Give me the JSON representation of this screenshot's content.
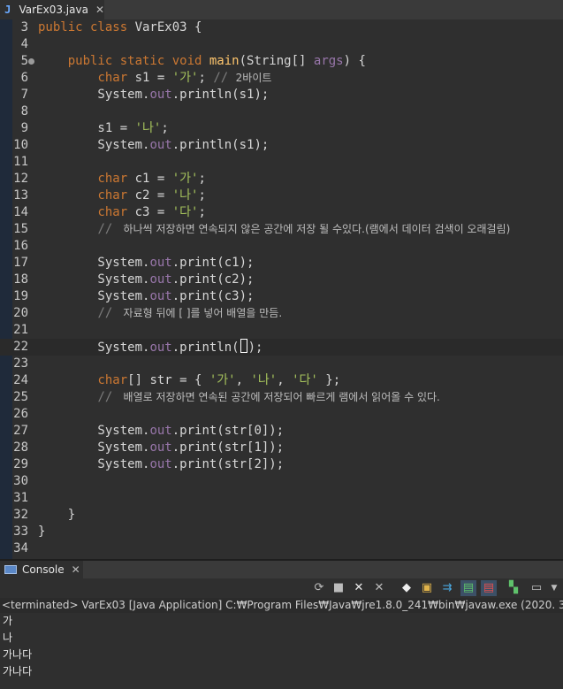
{
  "editor": {
    "tab_label": "VarEx03.java",
    "tab_icon": "J",
    "lines": [
      {
        "n": "3",
        "parts": [
          [
            "kw",
            "public class "
          ],
          [
            "plain",
            "VarEx03 {"
          ]
        ]
      },
      {
        "n": "4",
        "parts": []
      },
      {
        "n": "5",
        "fold": true,
        "parts": [
          [
            "plain",
            "    "
          ],
          [
            "kw",
            "public static void "
          ],
          [
            "fn",
            "main"
          ],
          [
            "plain",
            "(String[] "
          ],
          [
            "fld",
            "args"
          ],
          [
            "plain",
            ") {"
          ]
        ]
      },
      {
        "n": "6",
        "parts": [
          [
            "plain",
            "        "
          ],
          [
            "kw",
            "char "
          ],
          [
            "plain",
            "s1 = "
          ],
          [
            "str",
            "'가'"
          ],
          [
            "plain",
            "; "
          ],
          [
            "cm",
            "// "
          ],
          [
            "cmk",
            "2바이트"
          ]
        ]
      },
      {
        "n": "7",
        "parts": [
          [
            "plain",
            "        System."
          ],
          [
            "fld",
            "out"
          ],
          [
            "plain",
            ".println(s1);"
          ]
        ]
      },
      {
        "n": "8",
        "parts": []
      },
      {
        "n": "9",
        "parts": [
          [
            "plain",
            "        s1 = "
          ],
          [
            "str",
            "'나'"
          ],
          [
            "plain",
            ";"
          ]
        ]
      },
      {
        "n": "10",
        "parts": [
          [
            "plain",
            "        System."
          ],
          [
            "fld",
            "out"
          ],
          [
            "plain",
            ".println(s1);"
          ]
        ]
      },
      {
        "n": "11",
        "parts": []
      },
      {
        "n": "12",
        "parts": [
          [
            "plain",
            "        "
          ],
          [
            "kw",
            "char "
          ],
          [
            "plain",
            "c1 = "
          ],
          [
            "str",
            "'가'"
          ],
          [
            "plain",
            ";"
          ]
        ]
      },
      {
        "n": "13",
        "parts": [
          [
            "plain",
            "        "
          ],
          [
            "kw",
            "char "
          ],
          [
            "plain",
            "c2 = "
          ],
          [
            "str",
            "'나'"
          ],
          [
            "plain",
            ";"
          ]
        ]
      },
      {
        "n": "14",
        "parts": [
          [
            "plain",
            "        "
          ],
          [
            "kw",
            "char "
          ],
          [
            "plain",
            "c3 = "
          ],
          [
            "str",
            "'다'"
          ],
          [
            "plain",
            ";"
          ]
        ]
      },
      {
        "n": "15",
        "parts": [
          [
            "plain",
            "        "
          ],
          [
            "cm",
            "// "
          ],
          [
            "cmk",
            " 하나씩 저장하면 연속되지 않은 공간에 저장 될 수있다.(램에서 데이터 검색이 오래걸림)"
          ]
        ]
      },
      {
        "n": "16",
        "parts": []
      },
      {
        "n": "17",
        "parts": [
          [
            "plain",
            "        System."
          ],
          [
            "fld",
            "out"
          ],
          [
            "plain",
            ".print(c1);"
          ]
        ]
      },
      {
        "n": "18",
        "parts": [
          [
            "plain",
            "        System."
          ],
          [
            "fld",
            "out"
          ],
          [
            "plain",
            ".print(c2);"
          ]
        ]
      },
      {
        "n": "19",
        "parts": [
          [
            "plain",
            "        System."
          ],
          [
            "fld",
            "out"
          ],
          [
            "plain",
            ".print(c3);"
          ]
        ]
      },
      {
        "n": "20",
        "parts": [
          [
            "plain",
            "        "
          ],
          [
            "cm",
            "// "
          ],
          [
            "cmk",
            " 자료형 뒤에 [ ]를 넣어 배열을 만듬."
          ]
        ]
      },
      {
        "n": "21",
        "parts": []
      },
      {
        "n": "22",
        "current": true,
        "parts": [
          [
            "plain",
            "        System."
          ],
          [
            "fld",
            "out"
          ],
          [
            "plain",
            ".println("
          ],
          [
            "caret",
            ""
          ],
          [
            "plain",
            ");"
          ]
        ]
      },
      {
        "n": "23",
        "parts": []
      },
      {
        "n": "24",
        "parts": [
          [
            "plain",
            "        "
          ],
          [
            "kw",
            "char"
          ],
          [
            "plain",
            "[] str = { "
          ],
          [
            "str",
            "'가'"
          ],
          [
            "plain",
            ", "
          ],
          [
            "str",
            "'나'"
          ],
          [
            "plain",
            ", "
          ],
          [
            "str",
            "'다'"
          ],
          [
            "plain",
            " };"
          ]
        ]
      },
      {
        "n": "25",
        "parts": [
          [
            "plain",
            "        "
          ],
          [
            "cm",
            "// "
          ],
          [
            "cmk",
            " 배열로 저장하면 연속된 공간에 저장되어 빠르게 램에서 읽어올 수 있다."
          ]
        ]
      },
      {
        "n": "26",
        "parts": []
      },
      {
        "n": "27",
        "parts": [
          [
            "plain",
            "        System."
          ],
          [
            "fld",
            "out"
          ],
          [
            "plain",
            ".print(str[0]);"
          ]
        ]
      },
      {
        "n": "28",
        "parts": [
          [
            "plain",
            "        System."
          ],
          [
            "fld",
            "out"
          ],
          [
            "plain",
            ".print(str[1]);"
          ]
        ]
      },
      {
        "n": "29",
        "parts": [
          [
            "plain",
            "        System."
          ],
          [
            "fld",
            "out"
          ],
          [
            "plain",
            ".print(str[2]);"
          ]
        ]
      },
      {
        "n": "30",
        "parts": []
      },
      {
        "n": "31",
        "parts": []
      },
      {
        "n": "32",
        "parts": [
          [
            "plain",
            "    }"
          ]
        ]
      },
      {
        "n": "33",
        "parts": [
          [
            "plain",
            "}"
          ]
        ]
      },
      {
        "n": "34",
        "parts": []
      }
    ]
  },
  "console": {
    "tab_label": "Console",
    "status": "<terminated> VarEx03 [Java Application] C:₩Program Files₩Java₩jre1.8.0_241₩bin₩javaw.exe (2020. 3. 17. 오전 11:4",
    "output": [
      "가",
      "나",
      "가나다",
      "가나다"
    ],
    "toolbar_icons": [
      "refresh-icon",
      "stop-icon",
      "remove-launch-icon",
      "remove-all-icon",
      "clear-console-icon",
      "scroll-lock-icon",
      "word-wrap-icon",
      "show-on-stdout-icon",
      "show-on-stderr-icon",
      "pin-console-icon",
      "display-console-icon"
    ]
  },
  "colors": {
    "keyword": "#cc7832",
    "string": "#a5c25c",
    "field": "#9876aa",
    "method": "#ffc66d",
    "comment": "#7d7d7d",
    "background": "#2f2f2f"
  }
}
